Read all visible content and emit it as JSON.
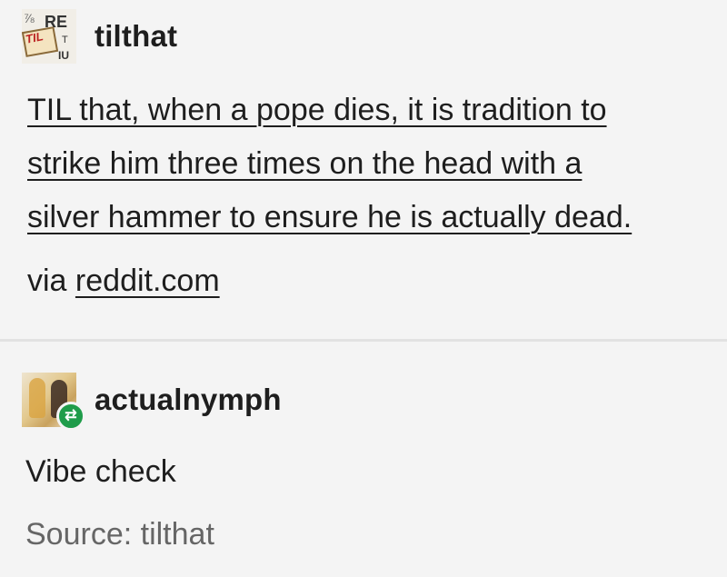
{
  "original_post": {
    "avatar": {
      "lines": [
        "RE",
        "TIL",
        "T",
        "IU"
      ],
      "icon": "til-book-avatar"
    },
    "username": "tilthat",
    "body_lines": [
      "TIL that, when a pope dies, it is tradition to",
      "strike him three times on the head with a",
      "silver hammer to ensure he is actually dead."
    ],
    "via_label": "via",
    "via_link": "reddit.com"
  },
  "reblog": {
    "avatar": {
      "icon": "user-photo-avatar"
    },
    "badge_icon": "reblog-icon",
    "badge_glyph": "⇄",
    "username": "actualnymph",
    "comment": "Vibe check",
    "source": "Source: tilthat"
  },
  "colors": {
    "background": "#f4f4f4",
    "text": "#1e1e1e",
    "muted": "#666666",
    "reblog_badge": "#1f9c4a",
    "divider": "#e2e2e2"
  }
}
